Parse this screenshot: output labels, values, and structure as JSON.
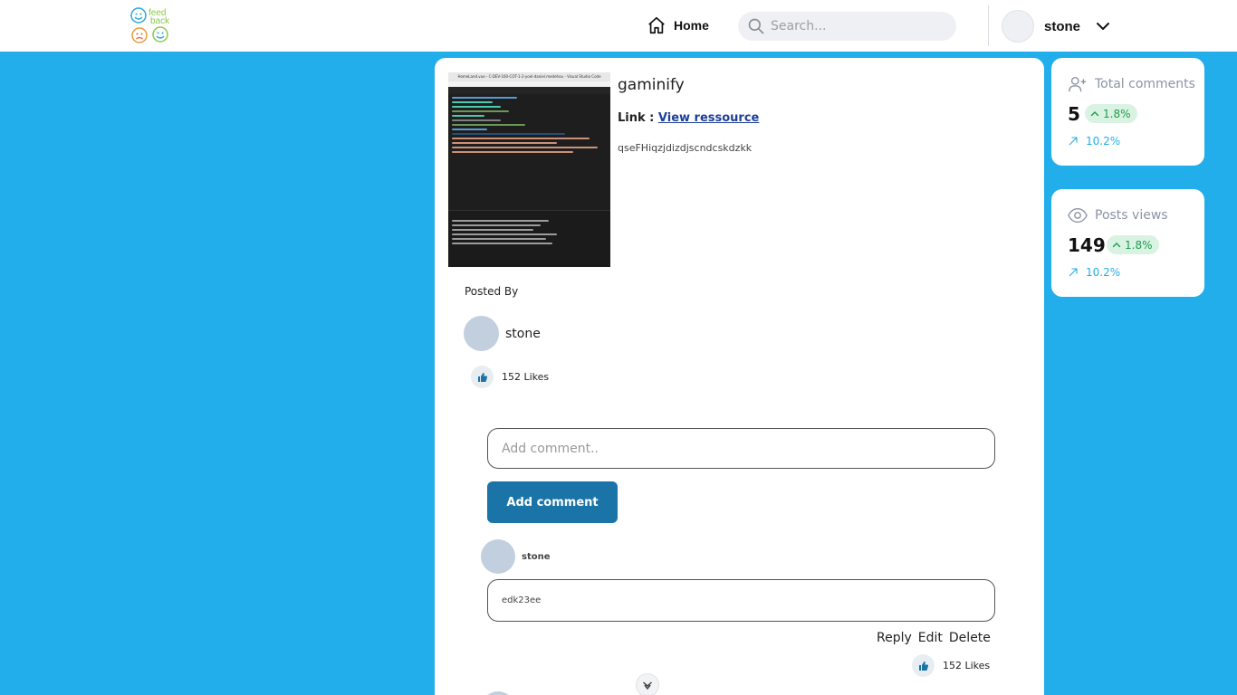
{
  "header": {
    "logo_text": "feed back",
    "nav_home": "Home",
    "search_placeholder": "Search...",
    "user_name": "stone"
  },
  "post": {
    "thumbnail_caption": "HomeLand.vue - C-DEV-160-COT-1-2-yoel-daniel.medehou - Visual Studio Code",
    "title": "gaminify",
    "link_label": "Link :",
    "link_text": "View ressource",
    "description": "qseFHiqzjdizdjscndcskdzkk",
    "posted_by_label": "Posted By",
    "author": "stone",
    "likes": "152 Likes"
  },
  "comment_form": {
    "placeholder": "Add comment..",
    "button_label": "Add comment"
  },
  "comments": [
    {
      "author": "stone",
      "text": "edk23ee",
      "actions": {
        "reply": "Reply",
        "edit": "Edit",
        "delete": "Delete"
      },
      "likes": "152 Likes"
    }
  ],
  "stats": [
    {
      "label": "Total comments",
      "value": "5",
      "change": "1.8%",
      "trend": "10.2%",
      "icon": "user-plus-icon"
    },
    {
      "label": "Posts views",
      "value": "149",
      "change": "1.8%",
      "trend": "10.2%",
      "icon": "eye-icon"
    }
  ],
  "colors": {
    "background": "#22aeea",
    "primary_button": "#1b74a8",
    "badge_bg": "#d9f3e2",
    "badge_text": "#1f9a4f",
    "link": "#1d3f9b"
  }
}
